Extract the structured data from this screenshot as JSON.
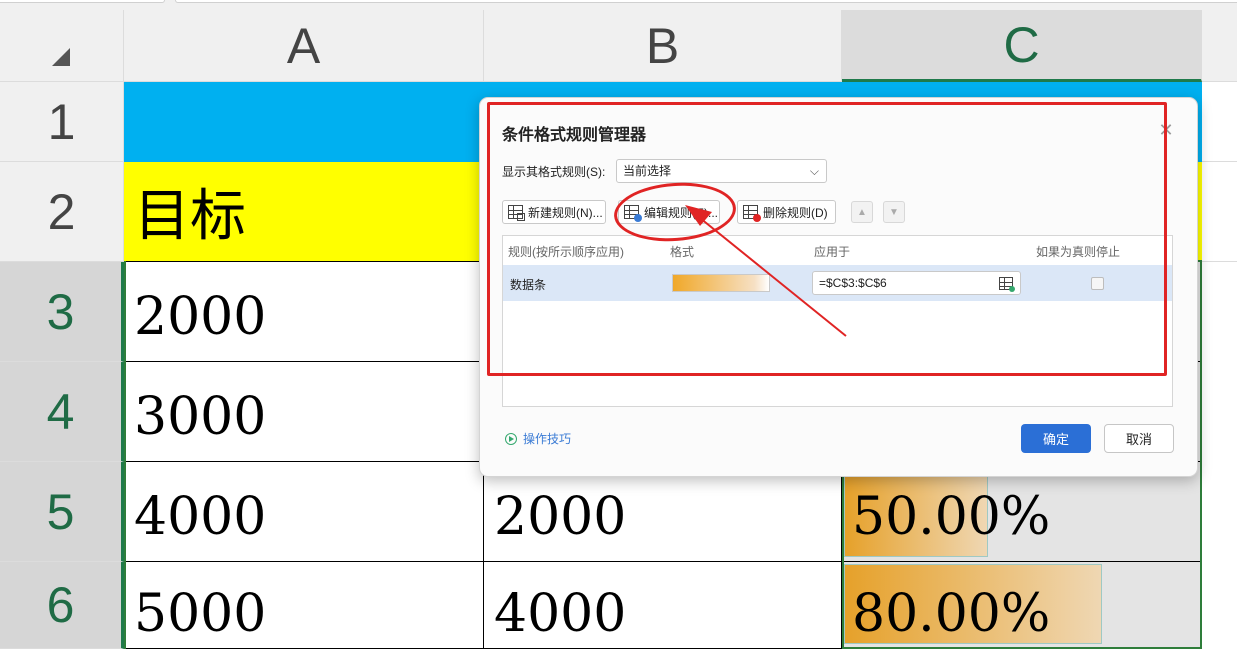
{
  "spreadsheet": {
    "columns": [
      "A",
      "B",
      "C"
    ],
    "rows": [
      "1",
      "2",
      "3",
      "4",
      "5",
      "6"
    ],
    "cells": {
      "A2": "目标",
      "A3": "2000",
      "A4": "3000",
      "A5": "4000",
      "A6": "5000",
      "B5": "2000",
      "B6": "4000",
      "C5": "50.00%",
      "C6": "80.00%"
    },
    "databars": {
      "C5": 0.5,
      "C6": 0.8
    },
    "colors": {
      "header_fill": "#00b0f0",
      "target_fill": "#ffff00",
      "selection": "#1f7a4b",
      "databar_start": "#e6a12a",
      "databar_end": "#efd7b3"
    }
  },
  "dialog": {
    "title": "条件格式规则管理器",
    "close_icon": "close-icon",
    "show_rules_label": "显示其格式规则(S):",
    "show_rules_value": "当前选择",
    "buttons": {
      "new_rule": "新建规则(N)...",
      "edit_rule": "编辑规则(E)...",
      "delete_rule": "删除规则(D)"
    },
    "table": {
      "headers": [
        "规则(按所示顺序应用)",
        "格式",
        "应用于",
        "如果为真则停止"
      ],
      "rows": [
        {
          "rule": "数据条",
          "format": "data-bar-preview",
          "applies_to": "=$C$3:$C$6",
          "stop_if_true": false
        }
      ]
    },
    "tips_label": "操作技巧",
    "ok_label": "确定",
    "cancel_label": "取消"
  },
  "annotation_color": "#e02424"
}
